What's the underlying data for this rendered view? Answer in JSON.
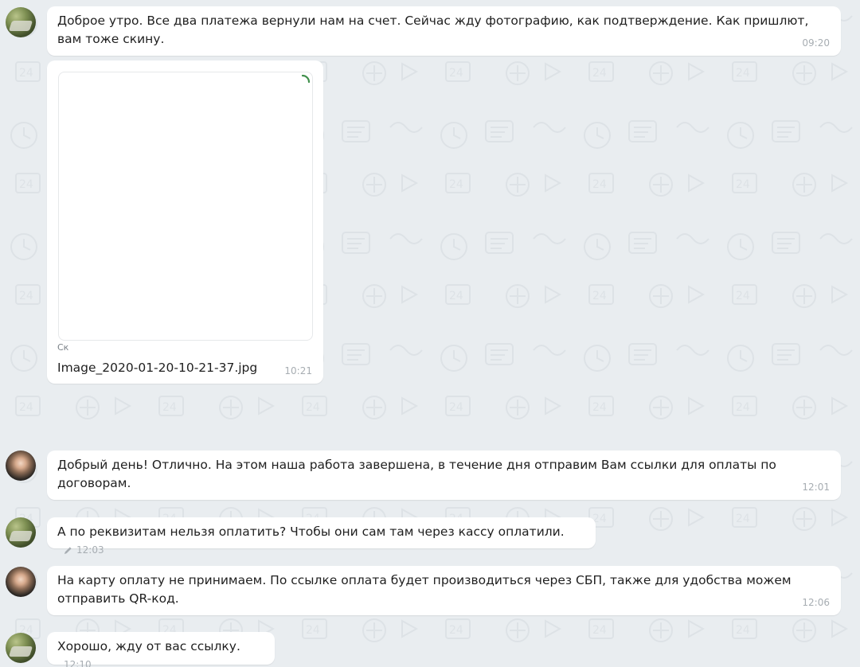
{
  "messages": [
    {
      "sender": "client",
      "text": "Доброе утро. Все два платежа вернули нам на счет. Сейчас жду фотографию, как подтверждение. Как пришлют, вам тоже скину.",
      "time": "09:20"
    },
    {
      "sender": "client",
      "type": "image",
      "caption": "Ск",
      "filename": "Image_2020-01-20-10-21-37.jpg",
      "time": "10:21"
    },
    {
      "sender": "manager",
      "text": "Добрый день! Отлично. На этом наша работа завершена, в течение дня отправим Вам ссылки для оплаты по договорам.",
      "time": "12:01"
    },
    {
      "sender": "client",
      "text": "А по реквизитам нельзя оплатить? Чтобы они сам там через кассу оплатили.",
      "time": "12:03",
      "edited": true
    },
    {
      "sender": "manager",
      "text": "На карту оплату не принимаем. По ссылке оплата будет производиться через СБП, также для удобства можем отправить QR-код.",
      "time": "12:06"
    },
    {
      "sender": "client",
      "text": "Хорошо, жду от вас ссылку.",
      "time": "12:10"
    }
  ],
  "icons": {
    "edit": "pencil-icon",
    "loading": "loading-spinner-icon"
  },
  "colors": {
    "background": "#e9edf0",
    "bubble": "#ffffff",
    "text": "#1f1f1f",
    "meta": "#a7adb2",
    "spinner": "#3f8f4a"
  }
}
